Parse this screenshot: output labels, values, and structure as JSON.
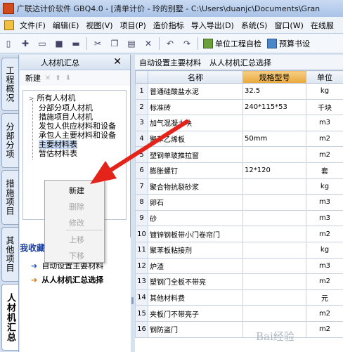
{
  "window": {
    "title": "广联达计价软件 GBQ4.0 - [清单计价 - 玲的别墅 - C:\\Users\\duanjc\\Documents\\Gran"
  },
  "menu": {
    "items": [
      "文件(F)",
      "编辑(E)",
      "视图(V)",
      "项目(P)",
      "造价指标",
      "导入导出(D)",
      "系统(S)",
      "窗口(W)",
      "在线服"
    ]
  },
  "toolbar": {
    "self_check": "单位工程自检",
    "preview": "预算书设"
  },
  "vtabs": [
    "工程概况",
    "分部分项",
    "措施项目",
    "其他项目",
    "人材机汇总"
  ],
  "left_panel": {
    "title": "人材机汇总",
    "new_label": "新建",
    "tree": [
      "所有人材机",
      "分部分项人材机",
      "措施项目人材机",
      "发包人供应材料和设备",
      "承包人主要材料和设备",
      "主要材料表",
      "暂估材料表"
    ],
    "context_menu": [
      {
        "label": "新建",
        "enabled": true
      },
      {
        "label": "删除",
        "enabled": false
      },
      {
        "label": "修改",
        "enabled": false
      },
      {
        "label": "上移",
        "enabled": false
      },
      {
        "label": "下移",
        "enabled": false
      }
    ],
    "favorites": {
      "title": "我收藏",
      "items": [
        "自动设置主要材料",
        "从人材机汇总选择"
      ]
    }
  },
  "right_panel": {
    "toolbar": [
      "自动设置主要材料",
      "从人材机汇总选择"
    ],
    "columns": [
      "",
      "名称",
      "规格型号",
      "单位"
    ],
    "rows": [
      [
        "1",
        "普通硅酸盐水泥",
        "32.5",
        "kg"
      ],
      [
        "2",
        "标准砖",
        "240*115*53",
        "千块"
      ],
      [
        "3",
        "加气混凝土块",
        "",
        "m3"
      ],
      [
        "4",
        "聚苯乙烯板",
        "50mm",
        "m2"
      ],
      [
        "5",
        "塑钢单玻推拉窗",
        "",
        "m2"
      ],
      [
        "6",
        "膨胀螺钉",
        "12*120",
        "套"
      ],
      [
        "7",
        "聚合物抗裂砂浆",
        "",
        "kg"
      ],
      [
        "8",
        "卵石",
        "",
        "m3"
      ],
      [
        "9",
        "砂",
        "",
        "m3"
      ],
      [
        "10",
        "镀锌钢板带小门卷帘门",
        "",
        "m2"
      ],
      [
        "11",
        "聚苯板粘接剂",
        "",
        "kg"
      ],
      [
        "12",
        "炉渣",
        "",
        "m3"
      ],
      [
        "13",
        "塑钢门全板不带亮",
        "",
        "m2"
      ],
      [
        "14",
        "其他材料费",
        "",
        "元"
      ],
      [
        "15",
        "夹板门不带亮子",
        "",
        "m2"
      ],
      [
        "16",
        "钢防盗门",
        "",
        "m2"
      ]
    ]
  },
  "colors": {
    "header_highlight": "#e9a83a",
    "arrow": "#e4231b",
    "favorites_title": "#1b3fa0"
  },
  "watermark": "Bai经验"
}
